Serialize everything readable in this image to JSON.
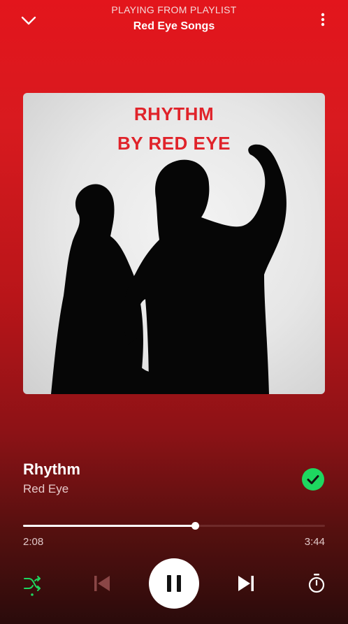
{
  "header": {
    "context_label": "PLAYING FROM PLAYLIST",
    "context_name": "Red Eye Songs",
    "back_icon": "chevron-down-icon",
    "menu_icon": "more-vertical-icon"
  },
  "artwork": {
    "line1": "RHYTHM",
    "line2": "BY RED EYE"
  },
  "track": {
    "title": "Rhythm",
    "artist": "Red Eye",
    "liked": true
  },
  "progress": {
    "current": "2:08",
    "total": "3:44",
    "fraction": 0.571
  },
  "controls": {
    "shuffle_icon": "shuffle-icon",
    "previous_icon": "skip-previous-icon",
    "play_pause_icon": "pause-icon",
    "next_icon": "skip-next-icon",
    "timer_icon": "sleep-timer-icon"
  },
  "colors": {
    "accent_green": "#1ed760",
    "art_title_red": "#e0232a"
  }
}
